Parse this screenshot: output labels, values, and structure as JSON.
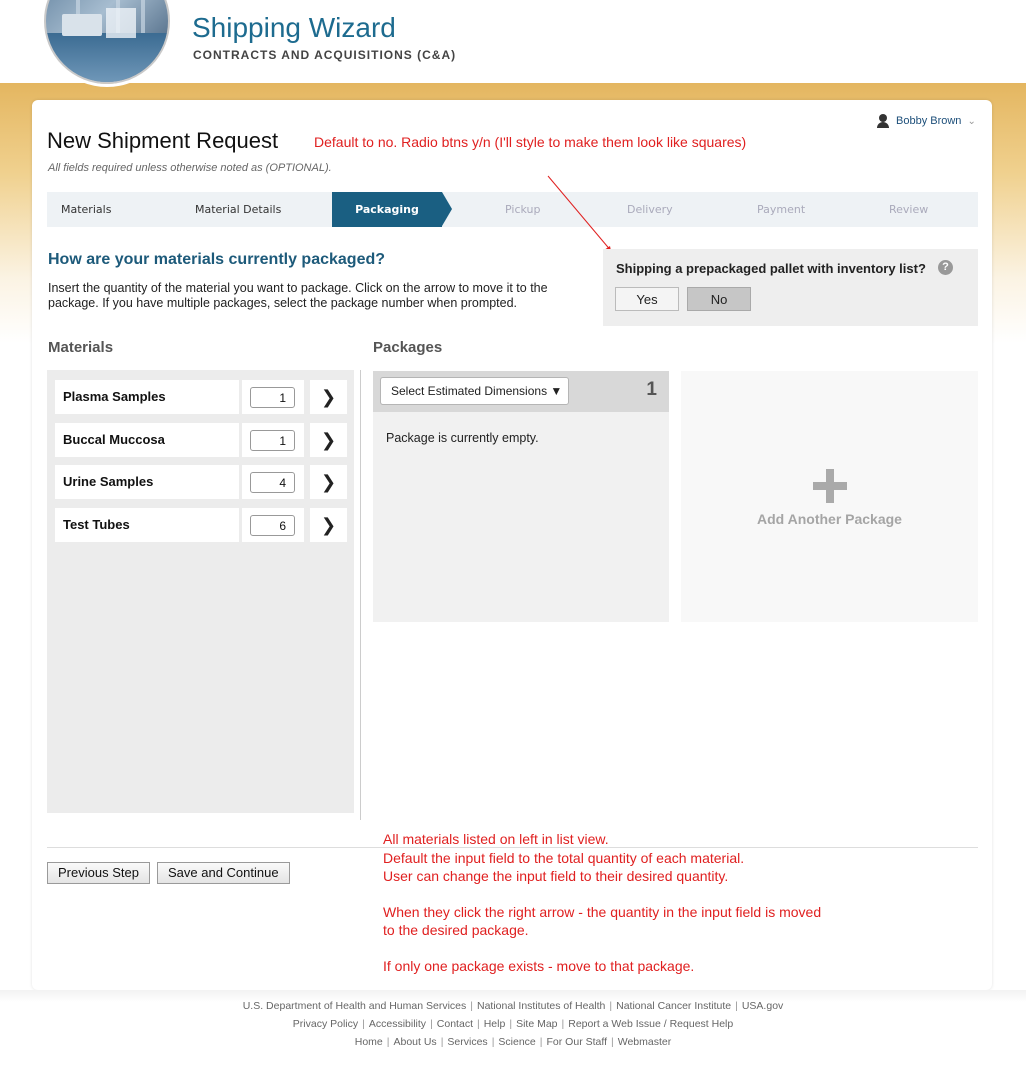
{
  "header": {
    "title": "Shipping Wizard",
    "subtitle": "CONTRACTS AND ACQUISITIONS (C&A)"
  },
  "user": {
    "name": "Bobby Brown",
    "icon": "person-icon"
  },
  "page": {
    "title": "New Shipment Request",
    "required_note": "All fields required unless otherwise noted as (OPTIONAL)."
  },
  "annotations": {
    "radio_note": "Default to no. Radio btns y/n (I'll style to make them look like squares)",
    "bottom_lines": [
      "All materials listed on left in list view.",
      "Default the input field to the total quantity of each material.",
      "User can change the input field to their desired quantity.",
      "When they click the right arrow - the quantity in the input field is moved",
      "to the desired package.",
      "If only one package exists - move to that package."
    ]
  },
  "steps": [
    "Materials",
    "Material Details",
    "Packaging",
    "Pickup",
    "Delivery",
    "Payment",
    "Review"
  ],
  "active_step": "Packaging",
  "question": {
    "title": "How are your materials currently packaged?",
    "instructions": "Insert the quantity of the material you want to package. Click on the arrow to move it to the package. If you have multiple packages, select the package number when prompted."
  },
  "pallet": {
    "question": "Shipping a prepackaged pallet with inventory list?",
    "yes_label": "Yes",
    "no_label": "No",
    "selected": "No"
  },
  "materials": {
    "heading": "Materials",
    "items": [
      {
        "label": "Plasma Samples",
        "qty": "1"
      },
      {
        "label": "Buccal Muccosa",
        "qty": "1"
      },
      {
        "label": "Urine Samples",
        "qty": "4"
      },
      {
        "label": "Test Tubes",
        "qty": "6"
      }
    ],
    "arrow_glyph": "❯"
  },
  "packages": {
    "heading": "Packages",
    "select_label": "Select Estimated Dimensions ▼",
    "number": "1",
    "empty_text": "Package is currently empty.",
    "add_label": "Add Another Package"
  },
  "buttons": {
    "previous": "Previous Step",
    "save": "Save and Continue"
  },
  "footer": {
    "row1": [
      "U.S. Department of Health and Human Services",
      "National Institutes of Health",
      "National Cancer Institute",
      "USA.gov"
    ],
    "row2": [
      "Privacy Policy",
      "Accessibility",
      "Contact",
      "Help",
      "Site Map",
      "Report a Web Issue / Request Help"
    ],
    "row3": [
      "Home",
      "About Us",
      "Services",
      "Science",
      "For Our Staff",
      "Webmaster"
    ]
  },
  "colors": {
    "accent": "#1a5f82",
    "title_blue": "#1d6b8f",
    "annotation_red": "#e02020",
    "gold": "#e4b660"
  }
}
